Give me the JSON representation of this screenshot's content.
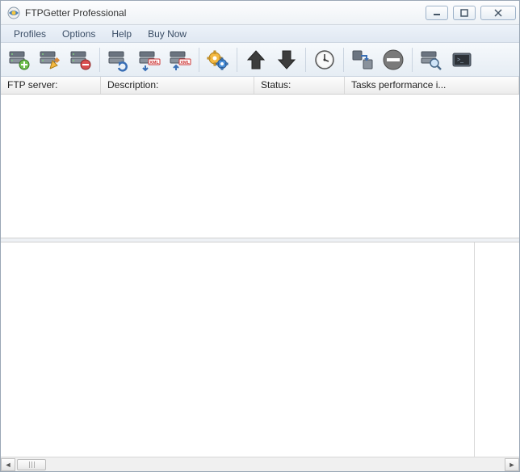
{
  "title": "FTPGetter Professional",
  "menu": {
    "profiles": "Profiles",
    "options": "Options",
    "help": "Help",
    "buynow": "Buy Now"
  },
  "columns": {
    "ftp_server": "FTP server:",
    "description": "Description:",
    "status": "Status:",
    "tasks_perf": "Tasks performance i..."
  }
}
